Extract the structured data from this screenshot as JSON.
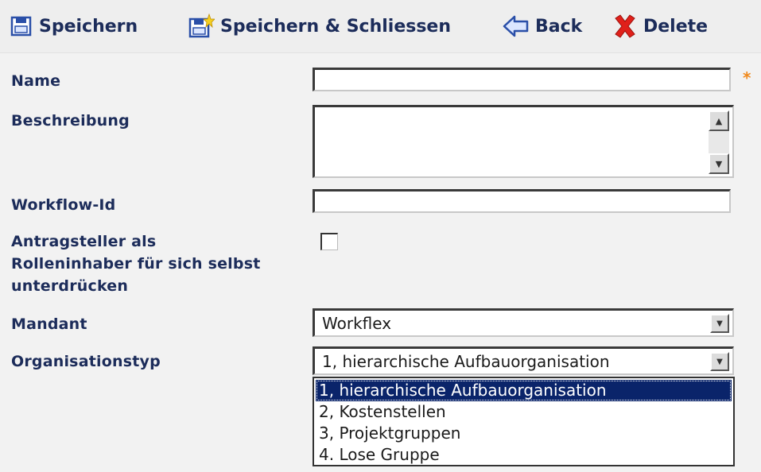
{
  "toolbar": {
    "save_label": "Speichern",
    "save_close_label": "Speichern & Schliessen",
    "back_label": "Back",
    "delete_label": "Delete"
  },
  "form": {
    "name_label": "Name",
    "name_value": "",
    "required_marker": "*",
    "description_label": "Beschreibung",
    "description_value": "",
    "workflow_id_label": "Workflow-Id",
    "workflow_id_value": "",
    "suppress_label_line1": "Antragsteller als",
    "suppress_label_line2": "Rolleninhaber für sich selbst",
    "suppress_label_line3": "unterdrücken",
    "suppress_checked": false,
    "mandant_label": "Mandant",
    "mandant_value": "Workflex",
    "orgtype_label": "Organisationstyp",
    "orgtype_value": "1, hierarchische Aufbauorganisation",
    "orgtype_options": [
      "1, hierarchische Aufbauorganisation",
      "2, Kostenstellen",
      "3, Projektgruppen",
      "4. Lose Gruppe"
    ],
    "orgtype_selected_index": 0
  },
  "colors": {
    "toolbar_text": "#1c2c5a",
    "required": "#f08a1e",
    "selection_bg": "#0a246a",
    "delete_icon": "#e0201a"
  },
  "icons": {
    "save": "floppy-disk-icon",
    "save_close": "floppy-disk-star-icon",
    "back": "back-arrow-icon",
    "delete": "red-x-icon"
  }
}
